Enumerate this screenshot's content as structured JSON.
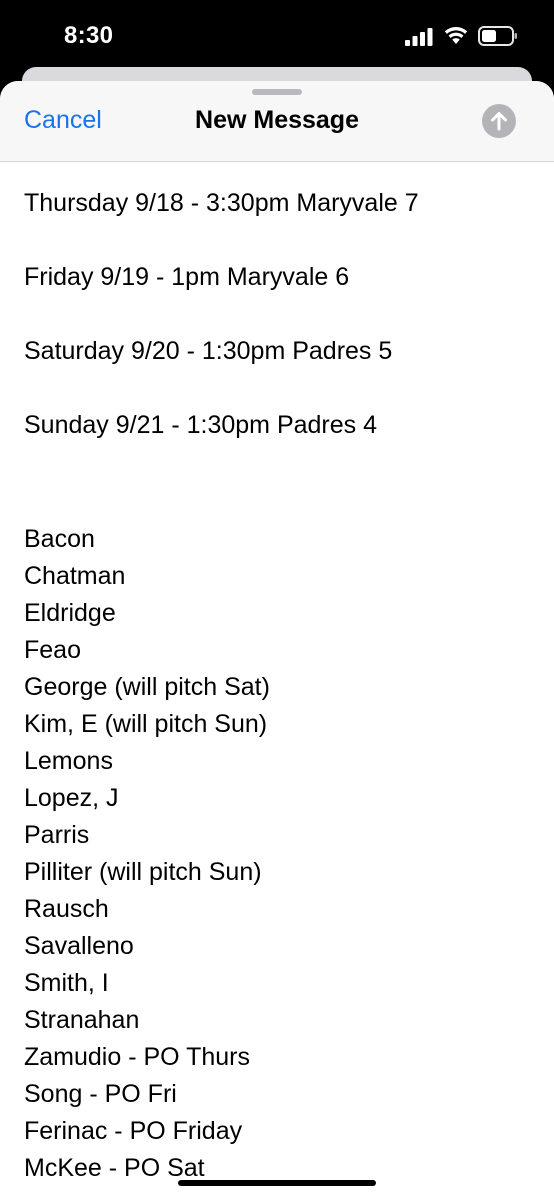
{
  "status_bar": {
    "time": "8:30"
  },
  "header": {
    "cancel_label": "Cancel",
    "title": "New Message"
  },
  "icons": {
    "signal": "cellular-signal-icon",
    "wifi": "wifi-icon",
    "battery": "battery-icon",
    "send": "arrow-up-icon"
  },
  "colors": {
    "accent": "#1a73e8",
    "send_disabled": "#b4b4b8"
  },
  "message": {
    "schedule": [
      "Thursday 9/18 - 3:30pm Maryvale 7",
      "Friday 9/19 - 1pm Maryvale 6",
      "Saturday 9/20 - 1:30pm Padres 5",
      "Sunday 9/21 - 1:30pm Padres 4"
    ],
    "roster": [
      "Bacon",
      "Chatman",
      "Eldridge",
      "Feao",
      "George (will pitch Sat)",
      "Kim, E (will pitch Sun)",
      "Lemons",
      "Lopez, J",
      "Parris",
      "Pilliter (will pitch Sun)",
      "Rausch",
      "Savalleno",
      "Smith, I",
      "Stranahan",
      "Zamudio - PO Thurs",
      "Song - PO Fri",
      "Ferinac - PO Friday",
      "McKee - PO Sat"
    ]
  }
}
